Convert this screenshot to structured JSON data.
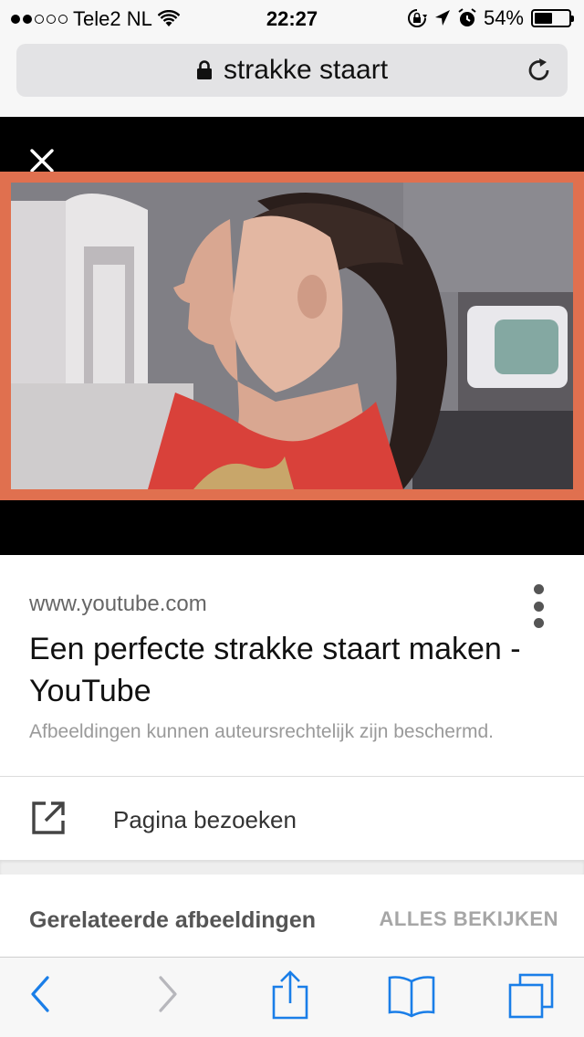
{
  "status_bar": {
    "carrier": "Tele2 NL",
    "time": "22:27",
    "battery_percent": "54%",
    "battery_level": 0.54,
    "signal_bars_filled": 2,
    "signal_bars_total": 5,
    "icons": [
      "wifi-icon",
      "rotation-lock-icon",
      "location-icon",
      "alarm-icon",
      "battery-icon"
    ]
  },
  "address_bar": {
    "text": "strakke staart",
    "icons": [
      "lock-icon",
      "reload-icon"
    ]
  },
  "image_viewer": {
    "close_icon": "close-icon",
    "border_color": "#e0704f"
  },
  "result": {
    "domain": "www.youtube.com",
    "title": "Een perfecte strakke staart maken - YouTube",
    "copyright_notice": "Afbeeldingen kunnen auteursrechtelijk zijn beschermd.",
    "visit_label": "Pagina bezoeken"
  },
  "related": {
    "title": "Gerelateerde afbeeldingen",
    "view_all": "ALLES BEKIJKEN"
  },
  "toolbar": {
    "icons": [
      "back-icon",
      "forward-icon",
      "share-icon",
      "bookmarks-icon",
      "tabs-icon"
    ],
    "accent_color": "#1a7ee8"
  }
}
